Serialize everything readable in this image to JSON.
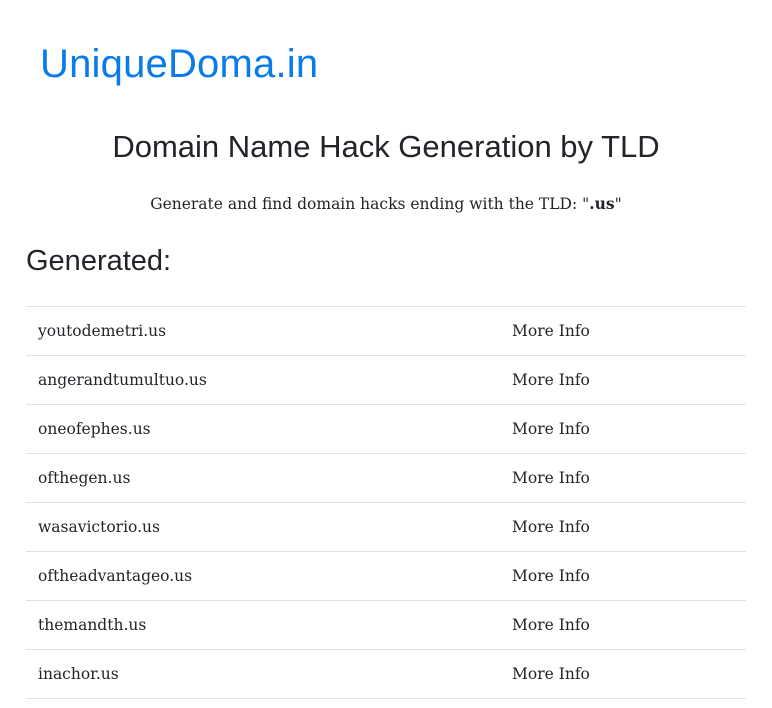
{
  "header": {
    "brand": "UniqueDoma.in"
  },
  "main": {
    "title": "Domain Name Hack Generation by TLD",
    "subtitle_prefix": "Generate and find domain hacks ending with the TLD: \"",
    "tld": ".us",
    "subtitle_suffix": "\"",
    "section_heading": "Generated:"
  },
  "results": [
    {
      "domain": "youtodemetri.us",
      "action": "More Info"
    },
    {
      "domain": "angerandtumultuo.us",
      "action": "More Info"
    },
    {
      "domain": "oneofephes.us",
      "action": "More Info"
    },
    {
      "domain": "ofthegen.us",
      "action": "More Info"
    },
    {
      "domain": "wasavictorio.us",
      "action": "More Info"
    },
    {
      "domain": "oftheadvantageo.us",
      "action": "More Info"
    },
    {
      "domain": "themandth.us",
      "action": "More Info"
    },
    {
      "domain": "inachor.us",
      "action": "More Info"
    }
  ],
  "colors": {
    "brand": "#0a7bea",
    "text": "#212529",
    "border": "#dee2e6"
  }
}
